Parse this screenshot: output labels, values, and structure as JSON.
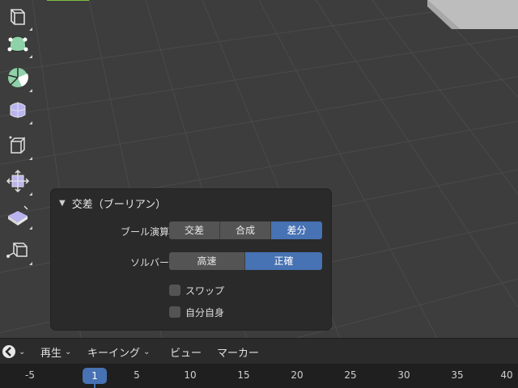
{
  "operator_panel": {
    "title": "交差（ブーリアン）",
    "operation": {
      "label": "ブール演算",
      "options": [
        "交差",
        "合成",
        "差分"
      ],
      "selected": "差分"
    },
    "solver": {
      "label": "ソルバー",
      "options": [
        "高速",
        "正確"
      ],
      "selected": "正確"
    },
    "checkboxes": [
      {
        "label": "スワップ",
        "checked": false
      },
      {
        "label": "自分自身",
        "checked": false
      }
    ]
  },
  "timeline": {
    "menus": [
      "再生",
      "キーイング",
      "ビュー",
      "マーカー"
    ],
    "ruler_labels": [
      "-5",
      "5",
      "10",
      "15",
      "20",
      "25",
      "30",
      "35",
      "40"
    ],
    "current_frame": "1"
  },
  "colors": {
    "accent": "#4772b3",
    "tool_green": "#8fd1a8",
    "tool_purple": "#b9b3f0"
  },
  "icons": {
    "tools": [
      "cube-add-icon",
      "poly-build-icon",
      "spin-icon",
      "smooth-icon",
      "extrude-icon",
      "shrink-fatten-icon",
      "shear-icon",
      "rip-region-icon"
    ],
    "editor_type": "timeline-editor-icon"
  }
}
